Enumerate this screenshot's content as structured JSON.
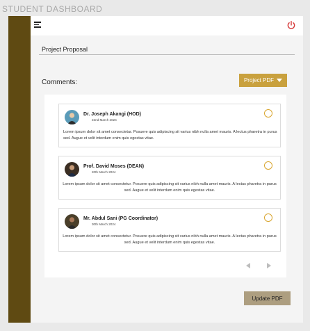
{
  "page_label": "STUDENT DASHBOARD",
  "section_title": "Project Proposal",
  "comments_label": "Comments:",
  "pdf_button_label": "Project PDF",
  "update_button_label": "Update PDF",
  "colors": {
    "sidebar": "#5f4a12",
    "accent": "#c9a13e",
    "update_button": "#ad9e80",
    "power_icon": "#d63a3a"
  },
  "comments": [
    {
      "name": "Dr. Joseph Akangi (HOD)",
      "date": "22nd March 2024",
      "text": "Lorem ipsum dolor sit amet consectetur. Posuere quis adipiscing sit varius nibh nulla amet mauris. A lectus pharetra in purus sed. Augue et velit interdum enim quis egestas vitae."
    },
    {
      "name": "Prof. David Moses (DEAN)",
      "date": "20th March 2024",
      "text": "Lorem ipsum dolor sit amet consectetur. Posuere quis adipiscing sit varius nibh nulla amet mauris. A lectus pharetra in purus sed. Augue et velit interdum enim quis egestas vitae."
    },
    {
      "name": "Mr. Abdul Sani (PG Coordinator)",
      "date": "30th March 2024",
      "text": "Lorem ipsum dolor sit amet consectetur. Posuere quis adipiscing sit varius nibh nulla amet mauris. A lectus pharetra in purus sed. Augue et velit interdum enim quis egestas vitae."
    }
  ],
  "icons": {
    "menu": "hamburger-menu-icon",
    "power": "power-icon",
    "prev": "chevron-left-icon",
    "next": "chevron-right-icon",
    "dropdown": "caret-down-icon"
  }
}
